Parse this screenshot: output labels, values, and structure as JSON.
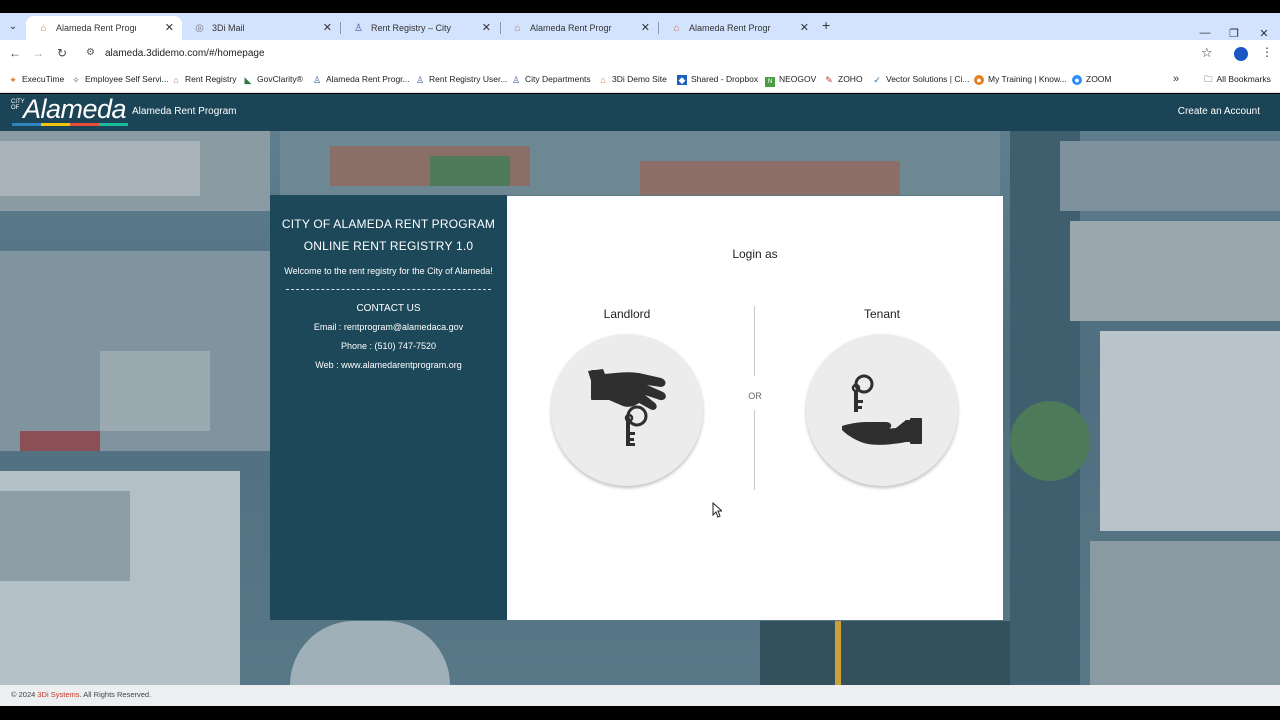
{
  "browser": {
    "tabs": [
      {
        "title": "Alameda Rent Program",
        "active": true
      },
      {
        "title": "3Di Mail",
        "active": false
      },
      {
        "title": "Rent Registry – City of Alameda",
        "active": false
      },
      {
        "title": "Alameda Rent Program",
        "active": false
      },
      {
        "title": "Alameda Rent Program",
        "active": false
      }
    ],
    "url": "alameda.3didemo.com/#/homepage",
    "bookmarks": [
      "ExecuTime",
      "Employee Self Servi...",
      "Rent Registry",
      "GovClarity®",
      "Alameda Rent Progr...",
      "Rent Registry User...",
      "City Departments",
      "3Di Demo Site",
      "Shared - Dropbox",
      "NEOGOV",
      "ZOHO",
      "Vector Solutions | Ci...",
      "My Training | Know...",
      "ZOOM"
    ],
    "all_bookmarks": "All Bookmarks"
  },
  "header": {
    "logo_city": "CITY OF",
    "logo_text": "Alameda",
    "site_name": "Alameda Rent Program",
    "create_account": "Create an Account",
    "logo_colors": [
      "#2e86c1",
      "#f1c40f",
      "#e74c3c",
      "#1abc9c"
    ]
  },
  "info": {
    "title_line1": "CITY OF ALAMEDA RENT PROGRAM",
    "title_line2": "ONLINE RENT REGISTRY 1.0",
    "welcome": "Welcome to the rent registry for the City of Alameda!",
    "contact_heading": "CONTACT US",
    "email": "Email : rentprogram@alamedaca.gov",
    "phone": "Phone : (510) 747-7520",
    "web": "Web : www.alamedarentprogram.org"
  },
  "login": {
    "heading": "Login as",
    "landlord": "Landlord",
    "tenant": "Tenant",
    "or": "OR"
  },
  "footer": {
    "prefix": "© 2024 ",
    "brand": "3Di Systems",
    "suffix": ". All Rights Reserved."
  }
}
